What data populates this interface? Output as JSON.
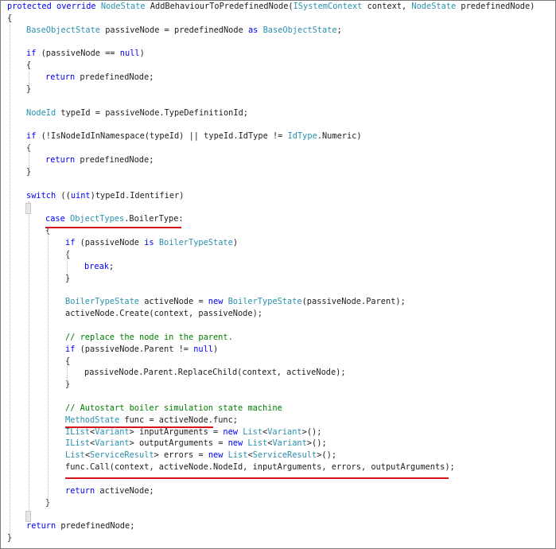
{
  "theme": {
    "keyword": "#0000ff",
    "type": "#2b91af",
    "comment": "#008000",
    "text": "#1e1e1e",
    "underline": "#d3141b"
  },
  "code_lines": [
    [
      [
        "k",
        "protected"
      ],
      [
        "p",
        " "
      ],
      [
        "k",
        "override"
      ],
      [
        "p",
        " "
      ],
      [
        "t",
        "NodeState"
      ],
      [
        "p",
        " AddBehaviourToPredefinedNode("
      ],
      [
        "t",
        "ISystemContext"
      ],
      [
        "p",
        " context, "
      ],
      [
        "t",
        "NodeState"
      ],
      [
        "p",
        " predefinedNode)"
      ]
    ],
    [
      [
        "p",
        "{"
      ]
    ],
    [
      [
        "t",
        "BaseObjectState"
      ],
      [
        "p",
        " passiveNode = predefinedNode "
      ],
      [
        "k",
        "as"
      ],
      [
        "p",
        " "
      ],
      [
        "t",
        "BaseObjectState"
      ],
      [
        "p",
        ";"
      ]
    ],
    [],
    [
      [
        "k",
        "if"
      ],
      [
        "p",
        " (passiveNode == "
      ],
      [
        "k",
        "null"
      ],
      [
        "p",
        ")"
      ]
    ],
    [
      [
        "p",
        "{"
      ]
    ],
    [
      [
        "k",
        "return"
      ],
      [
        "p",
        " predefinedNode;"
      ]
    ],
    [
      [
        "p",
        "}"
      ]
    ],
    [],
    [
      [
        "t",
        "NodeId"
      ],
      [
        "p",
        " typeId = passiveNode.TypeDefinitionId;"
      ]
    ],
    [],
    [
      [
        "k",
        "if"
      ],
      [
        "p",
        " (!IsNodeIdInNamespace(typeId) || typeId.IdType != "
      ],
      [
        "t",
        "IdType"
      ],
      [
        "p",
        ".Numeric)"
      ]
    ],
    [
      [
        "p",
        "{"
      ]
    ],
    [
      [
        "k",
        "return"
      ],
      [
        "p",
        " predefinedNode;"
      ]
    ],
    [
      [
        "p",
        "}"
      ]
    ],
    [],
    [
      [
        "k",
        "switch"
      ],
      [
        "p",
        " (("
      ],
      [
        "k",
        "uint"
      ],
      [
        "p",
        ")typeId.Identifier)"
      ]
    ],
    [
      [
        "p",
        "{"
      ]
    ],
    [
      [
        "k",
        "case"
      ],
      [
        "p",
        " "
      ],
      [
        "t",
        "ObjectTypes"
      ],
      [
        "p",
        ".BoilerType:"
      ]
    ],
    [
      [
        "p",
        "{"
      ]
    ],
    [
      [
        "k",
        "if"
      ],
      [
        "p",
        " (passiveNode "
      ],
      [
        "k",
        "is"
      ],
      [
        "p",
        " "
      ],
      [
        "t",
        "BoilerTypeState"
      ],
      [
        "p",
        ")"
      ]
    ],
    [
      [
        "p",
        "{"
      ]
    ],
    [
      [
        "k",
        "break"
      ],
      [
        "p",
        ";"
      ]
    ],
    [
      [
        "p",
        "}"
      ]
    ],
    [],
    [
      [
        "t",
        "BoilerTypeState"
      ],
      [
        "p",
        " activeNode = "
      ],
      [
        "k",
        "new"
      ],
      [
        "p",
        " "
      ],
      [
        "t",
        "BoilerTypeState"
      ],
      [
        "p",
        "(passiveNode.Parent);"
      ]
    ],
    [
      [
        "p",
        "activeNode.Create(context, passiveNode);"
      ]
    ],
    [],
    [
      [
        "c",
        "// replace the node in the parent."
      ]
    ],
    [
      [
        "k",
        "if"
      ],
      [
        "p",
        " (passiveNode.Parent != "
      ],
      [
        "k",
        "null"
      ],
      [
        "p",
        ")"
      ]
    ],
    [
      [
        "p",
        "{"
      ]
    ],
    [
      [
        "p",
        "passiveNode.Parent.ReplaceChild(context, activeNode);"
      ]
    ],
    [
      [
        "p",
        "}"
      ]
    ],
    [],
    [
      [
        "c",
        "// Autostart boiler simulation state machine"
      ]
    ],
    [
      [
        "t",
        "MethodState"
      ],
      [
        "p",
        " func = activeNode.func;"
      ]
    ],
    [
      [
        "t",
        "IList"
      ],
      [
        "p",
        "<"
      ],
      [
        "t",
        "Variant"
      ],
      [
        "p",
        "> inputArguments = "
      ],
      [
        "k",
        "new"
      ],
      [
        "p",
        " "
      ],
      [
        "t",
        "List"
      ],
      [
        "p",
        "<"
      ],
      [
        "t",
        "Variant"
      ],
      [
        "p",
        ">();"
      ]
    ],
    [
      [
        "t",
        "IList"
      ],
      [
        "p",
        "<"
      ],
      [
        "t",
        "Variant"
      ],
      [
        "p",
        "> outputArguments = "
      ],
      [
        "k",
        "new"
      ],
      [
        "p",
        " "
      ],
      [
        "t",
        "List"
      ],
      [
        "p",
        "<"
      ],
      [
        "t",
        "Variant"
      ],
      [
        "p",
        ">();"
      ]
    ],
    [
      [
        "t",
        "List"
      ],
      [
        "p",
        "<"
      ],
      [
        "t",
        "ServiceResult"
      ],
      [
        "p",
        "> errors = "
      ],
      [
        "k",
        "new"
      ],
      [
        "p",
        " "
      ],
      [
        "t",
        "List"
      ],
      [
        "p",
        "<"
      ],
      [
        "t",
        "ServiceResult"
      ],
      [
        "p",
        ">();"
      ]
    ],
    [
      [
        "p",
        "func.Call(context, activeNode.NodeId, inputArguments, errors, outputArguments);"
      ]
    ],
    [],
    [
      [
        "k",
        "return"
      ],
      [
        "p",
        " activeNode;"
      ]
    ],
    [
      [
        "p",
        "}"
      ]
    ],
    [
      [
        "p",
        "}"
      ]
    ],
    [
      [
        "k",
        "return"
      ],
      [
        "p",
        " predefinedNode;"
      ]
    ],
    [
      [
        "p",
        "}"
      ]
    ]
  ]
}
